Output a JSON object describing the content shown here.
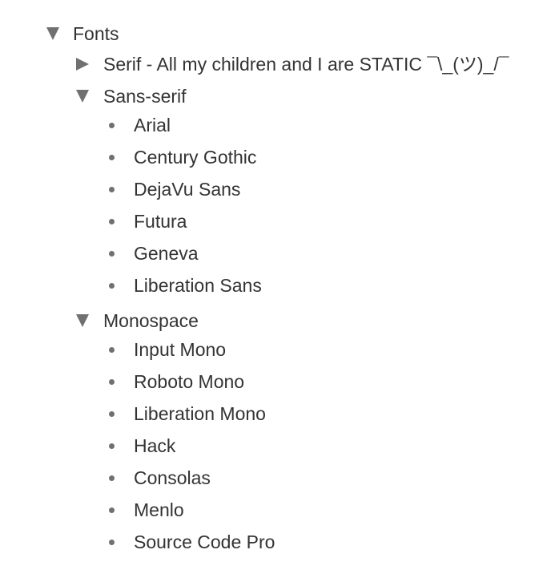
{
  "tree": {
    "root": {
      "label": "Fonts",
      "expanded": true,
      "children": {
        "serif": {
          "label": "Serif - All my children and I are STATIC ¯\\_(ツ)_/¯",
          "expanded": false
        },
        "sans_serif": {
          "label": "Sans-serif",
          "expanded": true,
          "items": [
            "Arial",
            "Century Gothic",
            "DejaVu Sans",
            "Futura",
            "Geneva",
            "Liberation Sans"
          ]
        },
        "monospace": {
          "label": "Monospace",
          "expanded": true,
          "items": [
            "Input Mono",
            "Roboto Mono",
            "Liberation Mono",
            "Hack",
            "Consolas",
            "Menlo",
            "Source Code Pro"
          ]
        }
      }
    }
  },
  "colors": {
    "text": "#333333",
    "toggle": "#707070",
    "background": "#ffffff"
  },
  "icons": {
    "expanded": "triangle-down-icon",
    "collapsed": "triangle-right-icon",
    "leaf": "bullet-icon"
  }
}
